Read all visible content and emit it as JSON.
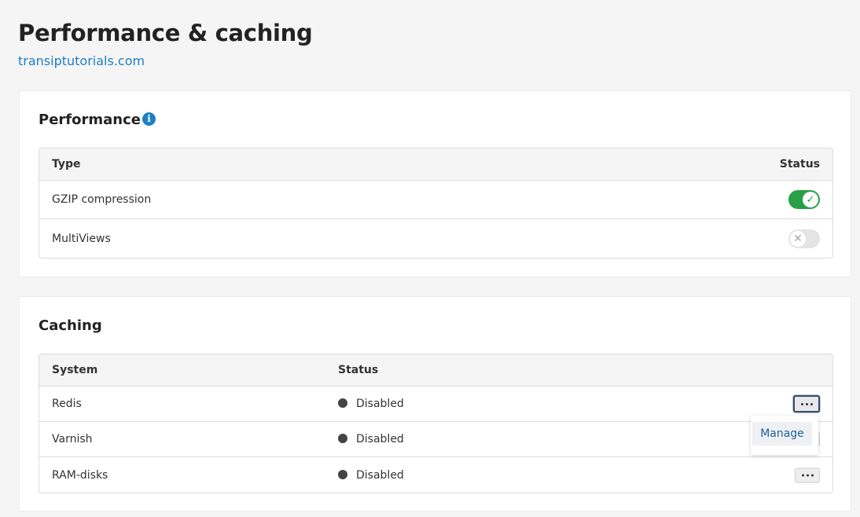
{
  "page": {
    "title": "Performance & caching",
    "domain": "transiptutorials.com"
  },
  "performance": {
    "title": "Performance",
    "info_icon": "info-icon",
    "headers": {
      "type": "Type",
      "status": "Status"
    },
    "rows": [
      {
        "type": "GZIP compression",
        "enabled": true
      },
      {
        "type": "MultiViews",
        "enabled": false
      }
    ]
  },
  "caching": {
    "title": "Caching",
    "headers": {
      "system": "System",
      "status": "Status"
    },
    "rows": [
      {
        "system": "Redis",
        "status": "Disabled"
      },
      {
        "system": "Varnish",
        "status": "Disabled"
      },
      {
        "system": "RAM-disks",
        "status": "Disabled"
      }
    ],
    "menu": {
      "open_row": "Redis",
      "items": [
        "Manage"
      ]
    }
  },
  "colors": {
    "accent": "#1d7fc4",
    "toggle_on": "#27a047",
    "toggle_off": "#e4e4e4"
  }
}
